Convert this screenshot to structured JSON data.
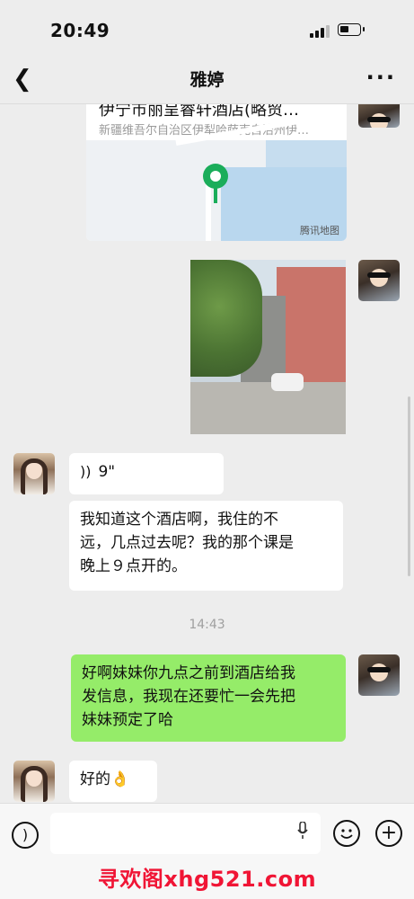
{
  "status_bar": {
    "time": "20:49"
  },
  "header": {
    "title": "雅婷",
    "back_icon": "chevron-left-icon",
    "more_icon": "more-dots-icon"
  },
  "messages": {
    "map_card": {
      "title": "伊宁市丽呈睿轩酒店(略贸…",
      "address": "新疆维吾尔自治区伊犁哈萨克自治州伊…",
      "brand": "腾讯地图"
    },
    "voice": {
      "duration": "9\""
    },
    "text1": {
      "line1": "我知道这个酒店啊，我住的不",
      "line2": "远，几点过去呢？我的那个课是",
      "line3": "晚上９点开的。"
    },
    "timestamp": "14:43",
    "text2": {
      "line1": "好啊妹妹你九点之前到酒店给我",
      "line2": "发信息，我现在还要忙一会先把",
      "line3": "妹妹预定了哈"
    },
    "text3": {
      "text": "好的👌"
    }
  },
  "input_bar": {
    "voice_icon": "voice-input-icon",
    "mic_icon": "microphone-icon",
    "emoji_icon": "emoji-icon",
    "plus_icon": "plus-icon",
    "watermark": "寻欢阁xhg521.com"
  },
  "colors": {
    "background": "#ededed",
    "self_bubble": "#95ec69",
    "other_bubble": "#ffffff",
    "watermark": "#f01535"
  }
}
